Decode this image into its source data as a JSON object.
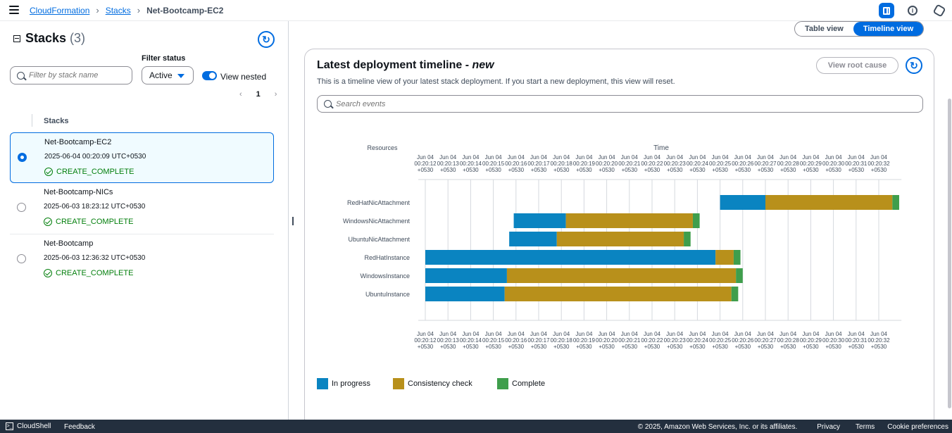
{
  "breadcrumbs": [
    "CloudFormation",
    "Stacks",
    "Net-Bootcamp-EC2"
  ],
  "left": {
    "title": "Stacks",
    "count": "(3)",
    "filter_placeholder": "Filter by stack name",
    "filter_status_label": "Filter status",
    "filter_status_value": "Active",
    "view_nested_label": "View nested",
    "page_number": "1",
    "column_header": "Stacks",
    "stacks": [
      {
        "name": "Net-Bootcamp-EC2",
        "time": "2025-06-04 00:20:09 UTC+0530",
        "status": "CREATE_COMPLETE",
        "selected": true
      },
      {
        "name": "Net-Bootcamp-NICs",
        "time": "2025-06-03 18:23:12 UTC+0530",
        "status": "CREATE_COMPLETE",
        "selected": false
      },
      {
        "name": "Net-Bootcamp",
        "time": "2025-06-03 12:36:32 UTC+0530",
        "status": "CREATE_COMPLETE",
        "selected": false
      }
    ]
  },
  "view_toggle": {
    "table": "Table view",
    "timeline": "Timeline view"
  },
  "panel": {
    "title": "Latest deployment timeline - ",
    "title_em": "new",
    "description": "This is a timeline view of your latest stack deployment. If you start a new deployment, this view will reset.",
    "root_cause_button": "View root cause",
    "search_placeholder": "Search events"
  },
  "chart_data": {
    "type": "gantt",
    "resources_label": "Resources",
    "time_label": "Time",
    "tick_date": "Jun 04",
    "tick_tz": "+0530",
    "ticks": [
      "00:20:12",
      "00:20:13",
      "00:20:14",
      "00:20:15",
      "00:20:16",
      "00:20:17",
      "00:20:18",
      "00:20:19",
      "00:20:20",
      "00:20:21",
      "00:20:22",
      "00:20:23",
      "00:20:24",
      "00:20:25",
      "00:20:26",
      "00:20:27",
      "00:20:28",
      "00:20:29",
      "00:20:30",
      "00:20:31",
      "00:20:32"
    ],
    "x_range_seconds": [
      12,
      32
    ],
    "rows": [
      {
        "resource": "RedHatNicAttachment",
        "in_progress": [
          25.0,
          27.0
        ],
        "consistency": [
          27.0,
          32.6
        ],
        "complete": [
          32.6,
          32.9
        ]
      },
      {
        "resource": "WindowsNicAttachment",
        "in_progress": [
          15.9,
          18.2
        ],
        "consistency": [
          18.2,
          23.8
        ],
        "complete": [
          23.8,
          24.1
        ]
      },
      {
        "resource": "UbuntuNicAttachment",
        "in_progress": [
          15.7,
          17.8
        ],
        "consistency": [
          17.8,
          23.4
        ],
        "complete": [
          23.4,
          23.7
        ]
      },
      {
        "resource": "RedHatInstance",
        "in_progress": [
          12.0,
          24.8
        ],
        "consistency": [
          24.8,
          25.6
        ],
        "complete": [
          25.6,
          25.9
        ]
      },
      {
        "resource": "WindowsInstance",
        "in_progress": [
          12.0,
          15.6
        ],
        "consistency": [
          15.6,
          25.7
        ],
        "complete": [
          25.7,
          26.0
        ]
      },
      {
        "resource": "UbuntuInstance",
        "in_progress": [
          12.0,
          15.5
        ],
        "consistency": [
          15.5,
          25.5
        ],
        "complete": [
          25.5,
          25.8
        ]
      }
    ],
    "legend": [
      {
        "label": "In progress",
        "color": "#0a84c1"
      },
      {
        "label": "Consistency check",
        "color": "#b8901b"
      },
      {
        "label": "Complete",
        "color": "#3f9e4c"
      }
    ]
  },
  "footer": {
    "cloudshell": "CloudShell",
    "feedback": "Feedback",
    "copyright": "© 2025, Amazon Web Services, Inc. or its affiliates.",
    "privacy": "Privacy",
    "terms": "Terms",
    "cookies": "Cookie preferences"
  }
}
